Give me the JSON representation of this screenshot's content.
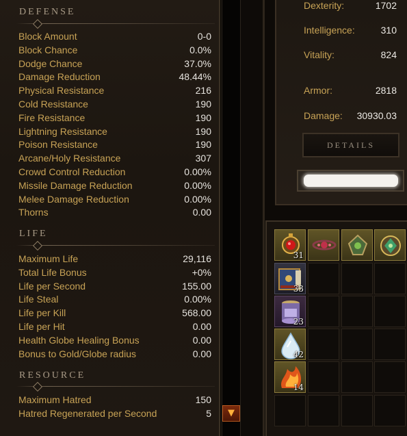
{
  "defense": {
    "heading": "DEFENSE",
    "rows": [
      {
        "label": "Block Amount",
        "value": "0-0"
      },
      {
        "label": "Block Chance",
        "value": "0.0%"
      },
      {
        "label": "Dodge Chance",
        "value": "37.0%"
      },
      {
        "label": "Damage Reduction",
        "value": "48.44%"
      },
      {
        "label": "Physical Resistance",
        "value": "216"
      },
      {
        "label": "Cold Resistance",
        "value": "190"
      },
      {
        "label": "Fire Resistance",
        "value": "190"
      },
      {
        "label": "Lightning Resistance",
        "value": "190"
      },
      {
        "label": "Poison Resistance",
        "value": "190"
      },
      {
        "label": "Arcane/Holy Resistance",
        "value": "307"
      },
      {
        "label": "Crowd Control Reduction",
        "value": "0.00%"
      },
      {
        "label": "Missile Damage Reduction",
        "value": "0.00%"
      },
      {
        "label": "Melee Damage Reduction",
        "value": "0.00%"
      },
      {
        "label": "Thorns",
        "value": "0.00"
      }
    ]
  },
  "life": {
    "heading": "LIFE",
    "rows": [
      {
        "label": "Maximum Life",
        "value": "29,116"
      },
      {
        "label": "Total Life Bonus",
        "value": "+0%"
      },
      {
        "label": "Life per Second",
        "value": "155.00"
      },
      {
        "label": "Life Steal",
        "value": "0.00%"
      },
      {
        "label": "Life per Kill",
        "value": "568.00"
      },
      {
        "label": "Life per Hit",
        "value": "0.00"
      },
      {
        "label": "Health Globe Healing Bonus",
        "value": "0.00"
      },
      {
        "label": "Bonus to Gold/Globe radius",
        "value": "0.00"
      }
    ]
  },
  "resource": {
    "heading": "RESOURCE",
    "rows": [
      {
        "label": "Maximum Hatred",
        "value": "150"
      },
      {
        "label": "Hatred Regenerated per Second",
        "value": "5"
      }
    ]
  },
  "attributes": [
    {
      "label": "Dexterity:",
      "value": "1702"
    },
    {
      "label": "Intelligence:",
      "value": "310"
    },
    {
      "label": "Vitality:",
      "value": "824"
    },
    {
      "label": "Armor:",
      "value": "2818"
    },
    {
      "label": "Damage:",
      "value": "30930.03"
    }
  ],
  "details_button": "DETAILS",
  "scroll_down_glyph": "▼",
  "inventory": {
    "stacks": [
      {
        "icon": "red-gem-amulet-icon",
        "count": "31"
      },
      {
        "icon": "spellbook-icon",
        "count": "33"
      },
      {
        "icon": "purple-jar-icon",
        "count": "23"
      },
      {
        "icon": "white-tear-icon",
        "count": "42"
      },
      {
        "icon": "fiery-essence-icon",
        "count": "14"
      }
    ],
    "top_row_items": [
      "ruby-ring-icon",
      "green-amulet-icon",
      "emerald-amulet-icon"
    ]
  },
  "colors": {
    "label_gold": "#c8a356",
    "value_white": "#e6e3de",
    "heading_grey": "#a89a86"
  }
}
